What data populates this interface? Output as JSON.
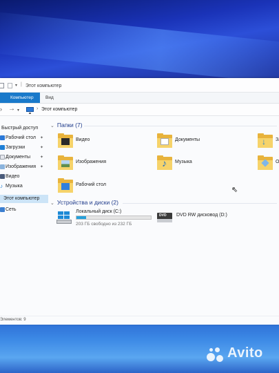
{
  "window": {
    "title": "Этот компьютер",
    "ribbon_tabs": {
      "file": "Компьютер",
      "view": "Вид"
    },
    "address": {
      "current": "Этот компьютер"
    }
  },
  "navigation": {
    "quick_access": "Быстрый доступ",
    "items": [
      {
        "label": "Рабочий стол",
        "pinned": true
      },
      {
        "label": "Загрузки",
        "pinned": true
      },
      {
        "label": "Документы",
        "pinned": true
      },
      {
        "label": "Изображения",
        "pinned": true
      },
      {
        "label": "Видео",
        "pinned": false
      },
      {
        "label": "Музыка",
        "pinned": false
      }
    ],
    "this_pc": "Этот компьютер",
    "network": "Сеть"
  },
  "folders": {
    "header": "Папки (7)",
    "items": [
      {
        "label": "Видео",
        "icon": "video-folder-icon"
      },
      {
        "label": "Документы",
        "icon": "documents-folder-icon"
      },
      {
        "label": "За",
        "icon": "downloads-folder-icon"
      },
      {
        "label": "Изображения",
        "icon": "pictures-folder-icon"
      },
      {
        "label": "Музыка",
        "icon": "music-folder-icon"
      },
      {
        "label": "О",
        "icon": "3d-objects-folder-icon"
      },
      {
        "label": "Рабочий стол",
        "icon": "desktop-folder-icon"
      }
    ]
  },
  "devices": {
    "header": "Устройства и диски (2)",
    "local_disk": {
      "label": "Локальный диск (C:)",
      "free_text": "203 ГБ свободно из 232 ГБ",
      "used_fraction": 0.125
    },
    "dvd": {
      "label": "DVD RW дисковод (D:)",
      "badge": "DVD"
    }
  },
  "status_bar": {
    "text": "Элементов: 9"
  },
  "watermark": {
    "text": "Avito"
  },
  "colors": {
    "accent": "#1979ca",
    "folder": "#e8b33c",
    "progress": "#26a0da",
    "selected_nav": "#cce4f7"
  }
}
